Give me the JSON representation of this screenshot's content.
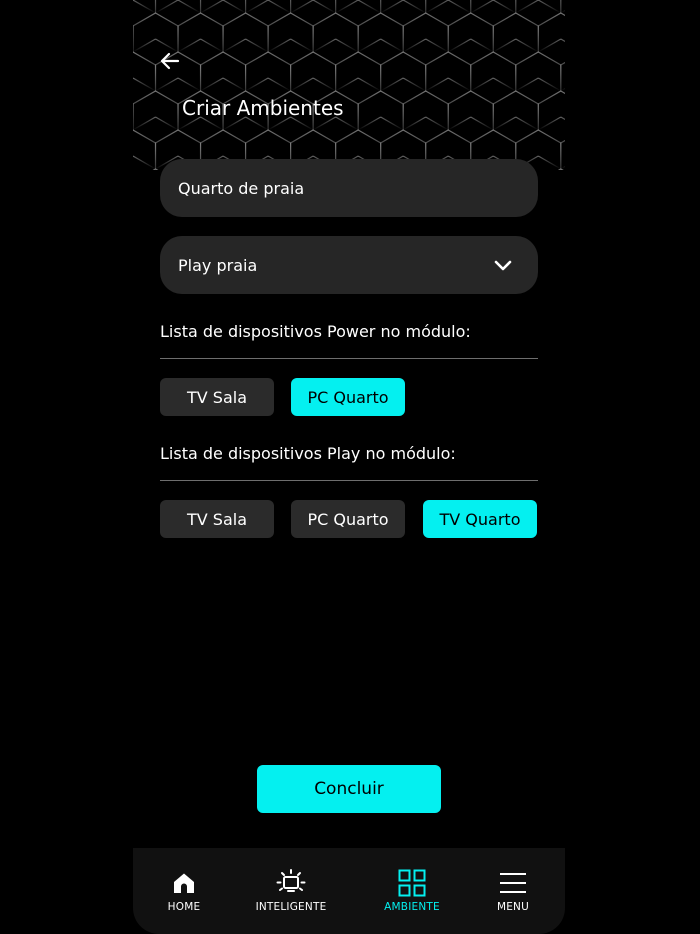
{
  "header": {
    "title": "Criar Ambientes",
    "back_icon": "arrow-left-icon"
  },
  "form": {
    "name_value": "Quarto de praia",
    "module_select": {
      "value": "Play praia",
      "icon": "chevron-down-icon"
    }
  },
  "power_section": {
    "label": "Lista de dispositivos Power no módulo:",
    "devices": [
      {
        "label": "TV Sala",
        "selected": false
      },
      {
        "label": "PC Quarto",
        "selected": true
      }
    ]
  },
  "play_section": {
    "label": "Lista de dispositivos Play no módulo:",
    "devices": [
      {
        "label": "TV Sala",
        "selected": false
      },
      {
        "label": "PC Quarto",
        "selected": false
      },
      {
        "label": "TV Quarto",
        "selected": true
      }
    ]
  },
  "actions": {
    "conclude_label": "Concluir"
  },
  "nav": {
    "items": [
      {
        "label": "HOME",
        "icon": "home-icon",
        "active": false
      },
      {
        "label": "INTELIGENTE",
        "icon": "smart-tv-icon",
        "active": false
      },
      {
        "label": "AMBIENTE",
        "icon": "grid-icon",
        "active": true
      },
      {
        "label": "MENU",
        "icon": "menu-icon",
        "active": false
      }
    ]
  },
  "colors": {
    "background": "#000000",
    "surface": "#262626",
    "chip": "#2b2b2b",
    "accent": "#04f0f0",
    "nav_background": "#111111"
  }
}
